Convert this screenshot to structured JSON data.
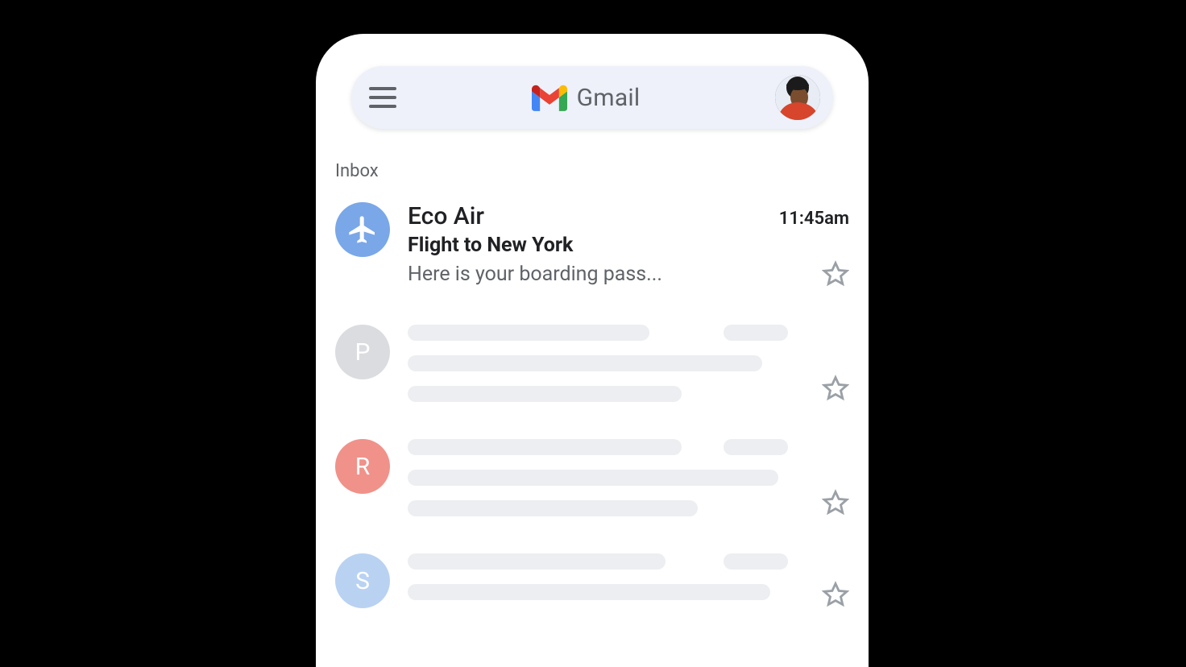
{
  "header": {
    "brand_name": "Gmail"
  },
  "inbox": {
    "section_label": "Inbox",
    "featured": {
      "sender": "Eco Air",
      "time": "11:45am",
      "subject": "Flight to New York",
      "preview": "Here is your boarding pass...",
      "avatar_icon": "airplane"
    },
    "skeletons": [
      {
        "initial": "P",
        "avatar_color": "grey"
      },
      {
        "initial": "R",
        "avatar_color": "pink"
      },
      {
        "initial": "S",
        "avatar_color": "lblue"
      }
    ]
  }
}
